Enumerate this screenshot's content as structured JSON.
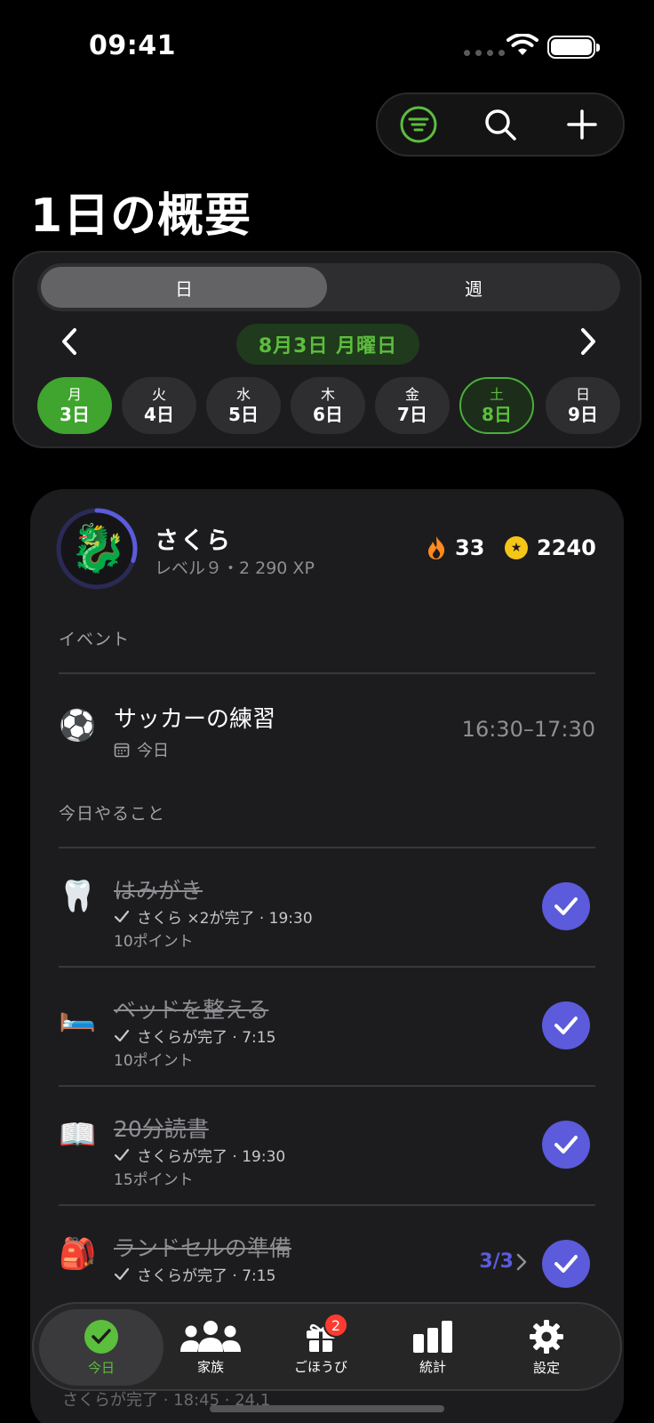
{
  "status": {
    "time": "09:41"
  },
  "page": {
    "title": "1日の概要"
  },
  "segment": {
    "day": "日",
    "week": "週"
  },
  "date_nav": {
    "current": "8月3日 月曜日",
    "days": [
      {
        "weekday": "月",
        "date": "3日"
      },
      {
        "weekday": "火",
        "date": "4日"
      },
      {
        "weekday": "水",
        "date": "5日"
      },
      {
        "weekday": "木",
        "date": "6日"
      },
      {
        "weekday": "金",
        "date": "7日"
      },
      {
        "weekday": "土",
        "date": "8日"
      },
      {
        "weekday": "日",
        "date": "9日"
      }
    ]
  },
  "profile": {
    "name": "さくら",
    "level": "レベル９・2 290 XP",
    "level_progress": 0.3,
    "streak": "33",
    "coins": "2240"
  },
  "events": {
    "header": "イベント",
    "items": [
      {
        "title": "サッカーの練習",
        "date": "今日",
        "time": "16:30–17:30"
      }
    ]
  },
  "tasks": {
    "header": "今日やること",
    "items": [
      {
        "title": "はみがき",
        "done": "さくら ×2が完了 · 19:30",
        "points": "10ポイント"
      },
      {
        "title": "ベッドを整える",
        "done": "さくらが完了 · 7:15",
        "points": "10ポイント"
      },
      {
        "title": "20分読書",
        "done": "さくらが完了 · 19:30",
        "points": "15ポイント"
      },
      {
        "title": "ランドセルの準備",
        "done": "さくらが完了 · 7:15",
        "points": "",
        "progress": "3/3"
      }
    ],
    "partial_next": "さくらが完了 · 18:45 · 24.1"
  },
  "tabbar": {
    "today": "今日",
    "family": "家族",
    "rewards": "ごほうび",
    "rewards_badge": "2",
    "stats": "統計",
    "settings": "設定"
  },
  "colors": {
    "accent_green": "#5cbe3d",
    "accent_purple": "#5b5bdb",
    "badge_red": "#ff3b30"
  }
}
